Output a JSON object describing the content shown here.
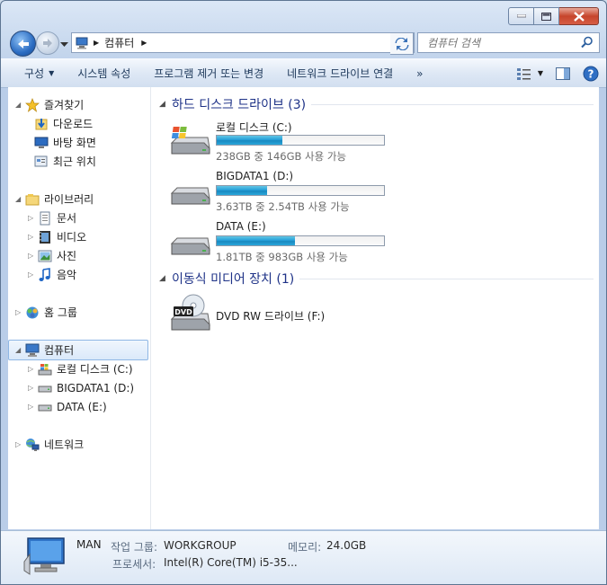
{
  "window": {
    "location": "컴퓨터"
  },
  "search": {
    "placeholder": "컴퓨터 검색"
  },
  "toolbar": {
    "organize": "구성",
    "system_properties": "시스템 속성",
    "uninstall": "프로그램 제거 또는 변경",
    "map_drive": "네트워크 드라이브 연결",
    "more": "»"
  },
  "nav": {
    "favorites": "즐겨찾기",
    "downloads": "다운로드",
    "desktop": "바탕 화면",
    "recent": "최근 위치",
    "libraries": "라이브러리",
    "documents": "문서",
    "videos": "비디오",
    "pictures": "사진",
    "music": "음악",
    "homegroup": "홈 그룹",
    "computer": "컴퓨터",
    "local_c": "로컬 디스크 (C:)",
    "bigdata_d": "BIGDATA1 (D:)",
    "data_e": "DATA (E:)",
    "network": "네트워크"
  },
  "groups": {
    "hdd": "하드 디스크 드라이브 (3)",
    "removable": "이동식 미디어 장치 (1)"
  },
  "drives": [
    {
      "name": "로컬 디스크 (C:)",
      "free": "238GB 중 146GB 사용 가능",
      "used_fraction": 0.39
    },
    {
      "name": "BIGDATA1 (D:)",
      "free": "3.63TB 중 2.54TB 사용 가능",
      "used_fraction": 0.3
    },
    {
      "name": "DATA (E:)",
      "free": "1.81TB 중 983GB 사용 가능",
      "used_fraction": 0.47
    }
  ],
  "dvd": {
    "name": "DVD RW 드라이브 (F:)",
    "label": "DVD"
  },
  "details": {
    "name": "MAN",
    "workgroup_label": "작업 그룹:",
    "workgroup": "WORKGROUP",
    "memory_label": "메모리:",
    "memory": "24.0GB",
    "cpu_label": "프로세서:",
    "cpu": "Intel(R) Core(TM) i5-35..."
  }
}
